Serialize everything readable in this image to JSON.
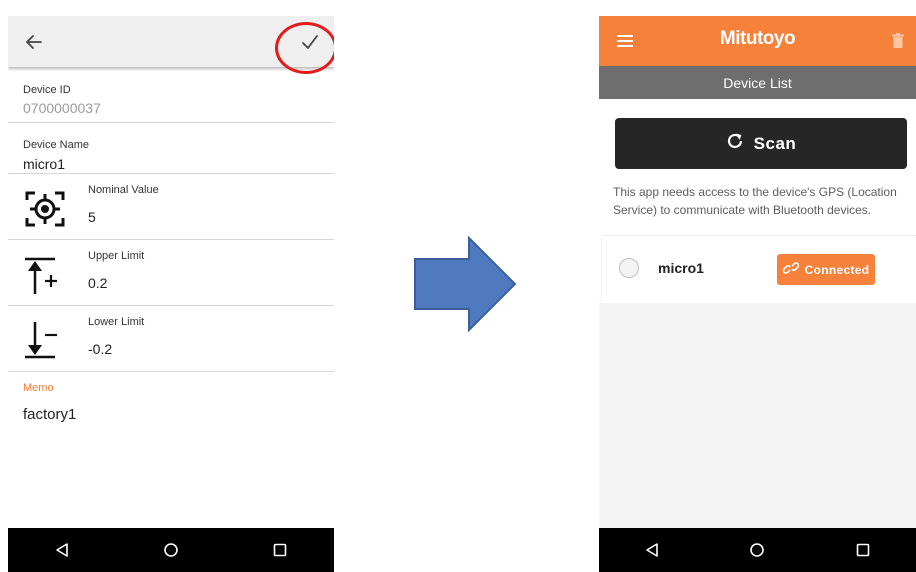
{
  "left_screen": {
    "fields": {
      "device_id": {
        "label": "Device ID",
        "value": "0700000037"
      },
      "device_name": {
        "label": "Device Name",
        "value": "micro1"
      },
      "nominal": {
        "label": "Nominal Value",
        "value": "5"
      },
      "upper": {
        "label": "Upper Limit",
        "value": "0.2"
      },
      "lower": {
        "label": "Lower Limit",
        "value": "-0.2"
      },
      "memo": {
        "label": "Memo",
        "value": "factory1"
      }
    },
    "icons": {
      "back": "back-arrow-icon",
      "confirm": "checkmark-icon",
      "nominal": "target-icon",
      "upper": "upper-limit-icon",
      "lower": "lower-limit-icon"
    },
    "colors": {
      "appbar": "#efeff0",
      "memo_label": "#f57c36",
      "highlight_circle": "#e31b1b"
    }
  },
  "right_screen": {
    "brand": "Mitutoyo",
    "subheader": "Device List",
    "scan_label": "Scan",
    "notice": "This app needs access to the device's GPS (Location Service) to communicate with Bluetooth devices.",
    "devices": [
      {
        "name": "micro1",
        "status": "Connected",
        "selected": false
      }
    ],
    "colors": {
      "appbar": "#f5813a",
      "subheader": "#6e6e6e",
      "scan_button": "#262626",
      "connected_button": "#f5813a"
    }
  },
  "nav_bar": [
    "back-triangle-icon",
    "home-circle-icon",
    "recents-square-icon"
  ],
  "transition_arrow": {
    "color": "#4f7ac0"
  }
}
